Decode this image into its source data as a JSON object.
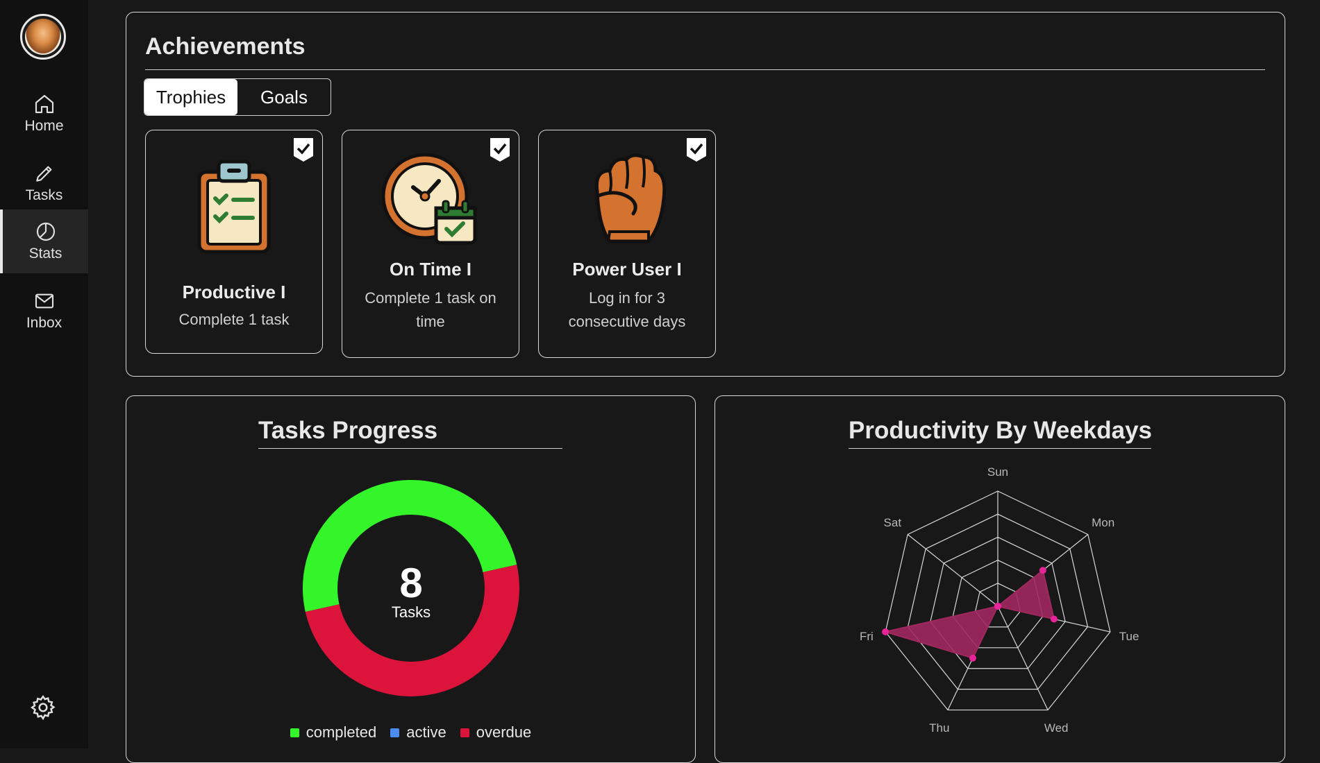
{
  "sidebar": {
    "items": [
      {
        "label": "Home",
        "icon": "home-icon"
      },
      {
        "label": "Tasks",
        "icon": "pencil-icon"
      },
      {
        "label": "Stats",
        "icon": "pie-chart-icon"
      },
      {
        "label": "Inbox",
        "icon": "mail-icon"
      }
    ],
    "active": "Stats",
    "settings_icon": "gear-icon"
  },
  "achievements": {
    "title": "Achievements",
    "tabs": [
      "Trophies",
      "Goals"
    ],
    "selected_tab": "Trophies",
    "cards": [
      {
        "title": "Productive I",
        "description": "Complete 1 task",
        "icon": "clipboard-checklist-icon",
        "unlocked": true
      },
      {
        "title": "On Time I",
        "description": "Complete 1 task on time",
        "icon": "clock-calendar-icon",
        "unlocked": true
      },
      {
        "title": "Power User I",
        "description": "Log in for 3 consecutive days",
        "icon": "fist-icon",
        "unlocked": true
      }
    ]
  },
  "tasks_progress": {
    "title": "Tasks Progress",
    "center_value": "8",
    "center_label": "Tasks"
  },
  "productivity": {
    "title": "Productivity By Weekdays"
  },
  "colors": {
    "completed": "#33f52a",
    "active": "#4a8cf0",
    "overdue": "#dc143c",
    "radar_fill": "#a0285f",
    "radar_point": "#e8249a"
  },
  "chart_data": [
    {
      "type": "pie",
      "variant": "donut",
      "categories": [
        "completed",
        "active",
        "overdue"
      ],
      "values": [
        4,
        0,
        4
      ],
      "legend": "bottom"
    },
    {
      "type": "radar",
      "categories": [
        "Sun",
        "Mon",
        "Tue",
        "Wed",
        "Thu",
        "Fri",
        "Sat"
      ],
      "series": [
        {
          "values": [
            0,
            2,
            2,
            0,
            2,
            4,
            0
          ]
        }
      ],
      "max": 4,
      "rings": 5
    }
  ]
}
